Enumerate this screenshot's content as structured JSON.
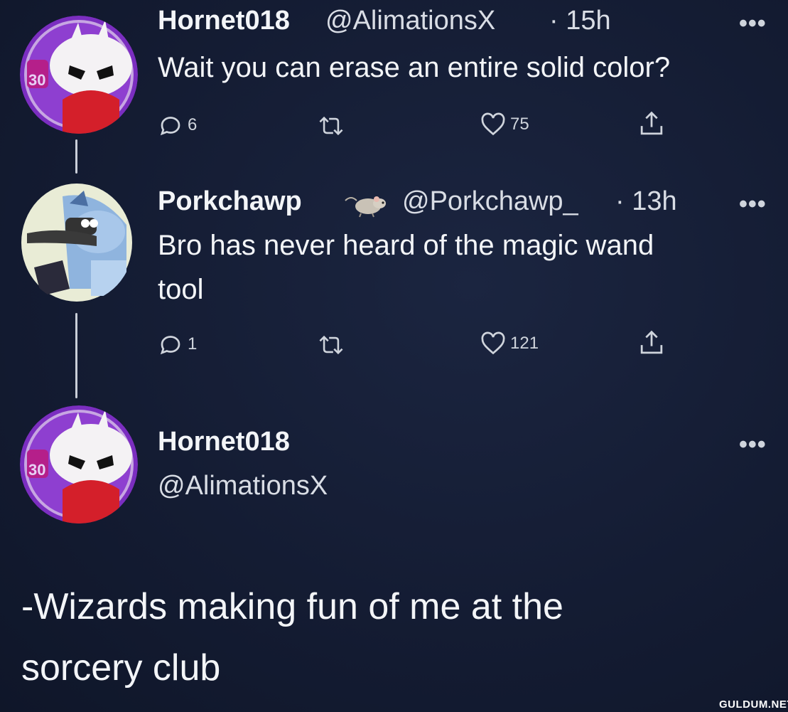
{
  "tweets": [
    {
      "name": "Hornet018",
      "handle": "@AlimationsX",
      "time": "· 15h",
      "text": "Wait you can erase an entire solid color?",
      "replies": "6",
      "likes": "75",
      "more": "•••"
    },
    {
      "name": "Porkchawp",
      "handle": "@Porkchawp_",
      "time": "· 13h",
      "text_line1": "Bro has never heard of the magic wand",
      "text_line2": "tool",
      "replies": "1",
      "likes": "121",
      "more": "•••"
    },
    {
      "name": "Hornet018",
      "handle": "@AlimationsX",
      "more": "•••"
    }
  ],
  "caption_line1": "-Wizards making fun of me at the",
  "caption_line2": "sorcery club",
  "watermark": "GULDUM.NET",
  "colors": {
    "background": "#141c33",
    "text": "#f3f5f8",
    "icon": "#cfd4dc",
    "avatar_purple": "#8a2bc7",
    "avatar_red": "#d41f2a"
  },
  "icons": [
    "reply-icon",
    "retweet-icon",
    "like-icon",
    "share-icon",
    "rat-emoji-icon",
    "more-icon"
  ]
}
